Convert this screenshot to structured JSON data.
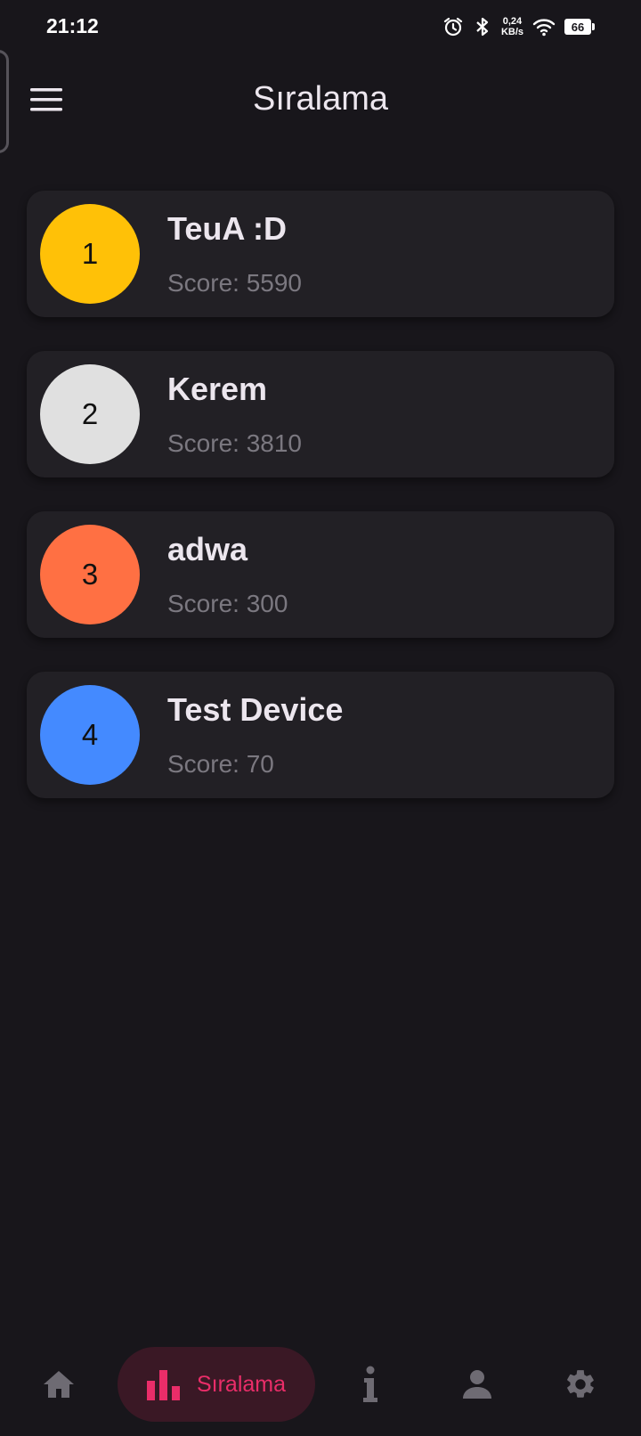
{
  "status_bar": {
    "time": "21:12",
    "net_speed_value": "0,24",
    "net_speed_unit": "KB/s",
    "battery_level": "66"
  },
  "app_bar": {
    "title": "Sıralama"
  },
  "rankings": [
    {
      "rank": "1",
      "name": "TeuA :D",
      "score": "Score: 5590",
      "color": "#ffc107"
    },
    {
      "rank": "2",
      "name": "Kerem",
      "score": "Score: 3810",
      "color": "#e0e0e0"
    },
    {
      "rank": "3",
      "name": "adwa",
      "score": "Score: 300",
      "color": "#ff7043"
    },
    {
      "rank": "4",
      "name": "Test Device",
      "score": "Score: 70",
      "color": "#448aff"
    }
  ],
  "bottom_nav": {
    "items": [
      {
        "icon": "home-icon"
      },
      {
        "icon": "bar-chart-icon",
        "label": "Sıralama",
        "active": true
      },
      {
        "icon": "info-icon"
      },
      {
        "icon": "person-icon"
      },
      {
        "icon": "gear-icon"
      }
    ],
    "active_color": "#ea2d69",
    "active_bg": "#3a1825",
    "inactive_color": "#6e6b73"
  }
}
